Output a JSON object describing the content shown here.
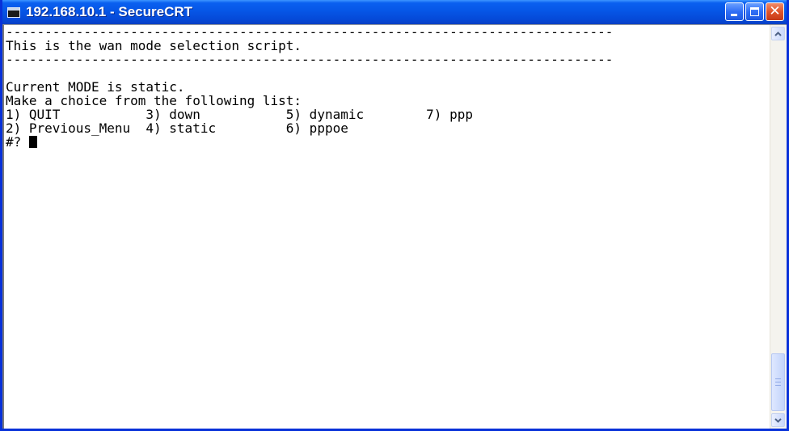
{
  "window": {
    "title": "192.168.10.1 - SecureCRT",
    "icon": "terminal-app-icon",
    "buttons": [
      "minimize-icon",
      "maximize-icon",
      "close-icon"
    ]
  },
  "terminal": {
    "lines": [
      "------------------------------------------------------------------------------",
      "This is the wan mode selection script.",
      "------------------------------------------------------------------------------",
      "",
      "Current MODE is static.",
      "Make a choice from the following list:",
      "1) QUIT           3) down           5) dynamic        7) ppp",
      "2) Previous_Menu  4) static         6) pppoe"
    ],
    "prompt": "#? "
  },
  "colors": {
    "titlebar": "#0a54e3",
    "terminal_background": "#ffffff",
    "terminal_text": "#000000"
  }
}
